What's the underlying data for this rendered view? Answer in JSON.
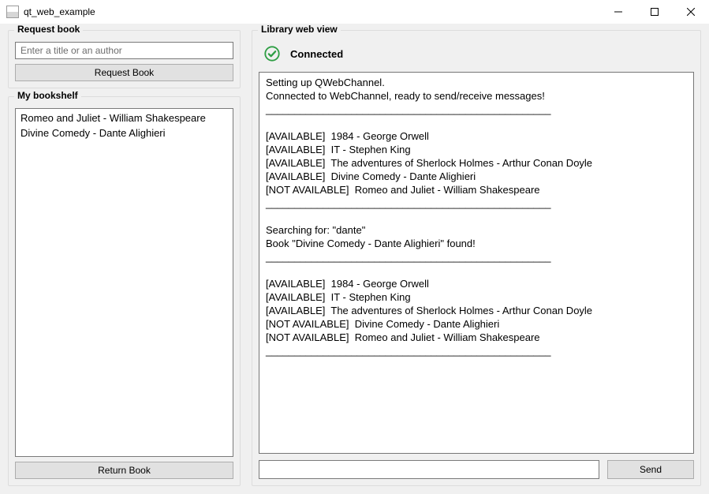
{
  "window": {
    "title": "qt_web_example"
  },
  "request_box": {
    "legend": "Request book",
    "input_placeholder": "Enter a title or an author",
    "input_value": "",
    "button_label": "Request Book"
  },
  "bookshelf_box": {
    "legend": "My bookshelf",
    "items": [
      "Romeo and Juliet - William Shakespeare",
      "Divine Comedy - Dante Alighieri"
    ],
    "return_button_label": "Return Book"
  },
  "library_box": {
    "legend": "Library web view",
    "status_text": "Connected",
    "console_text": "Setting up QWebChannel.\nConnected to WebChannel, ready to send/receive messages!\n__________________________________________________\n\n[AVAILABLE]  1984 - George Orwell\n[AVAILABLE]  IT - Stephen King\n[AVAILABLE]  The adventures of Sherlock Holmes - Arthur Conan Doyle\n[AVAILABLE]  Divine Comedy - Dante Alighieri\n[NOT AVAILABLE]  Romeo and Juliet - William Shakespeare\n__________________________________________________\n\nSearching for: \"dante\"\nBook \"Divine Comedy - Dante Alighieri\" found!\n__________________________________________________\n\n[AVAILABLE]  1984 - George Orwell\n[AVAILABLE]  IT - Stephen King\n[AVAILABLE]  The adventures of Sherlock Holmes - Arthur Conan Doyle\n[NOT AVAILABLE]  Divine Comedy - Dante Alighieri\n[NOT AVAILABLE]  Romeo and Juliet - William Shakespeare\n__________________________________________________",
    "send_input_value": "",
    "send_button_label": "Send"
  }
}
